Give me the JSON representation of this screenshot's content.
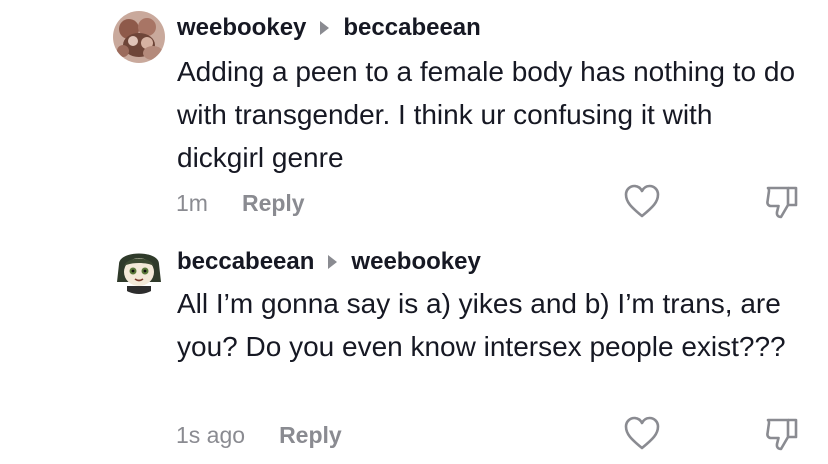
{
  "comments": [
    {
      "username": "weebookey",
      "reply_to": "beccabeean",
      "text": "Adding a peen to a female body has nothing to do with transgender. I think ur confusing it with dickgirl genre",
      "time": "1m",
      "reply_label": "Reply",
      "avatar_icon": "avatar-photo"
    },
    {
      "username": "beccabeean",
      "reply_to": "weebookey",
      "text": "All I’m gonna say is a) yikes and b) I’m trans, are you? Do you even know intersex people exist???",
      "time": "1s ago",
      "reply_label": "Reply",
      "avatar_icon": "avatar-cartoon"
    }
  ],
  "icons": {
    "like": "heart-outline-icon",
    "dislike": "thumbs-down-outline-icon"
  },
  "colors": {
    "text": "#161823",
    "secondary": "#8a8b91",
    "background": "#ffffff"
  }
}
